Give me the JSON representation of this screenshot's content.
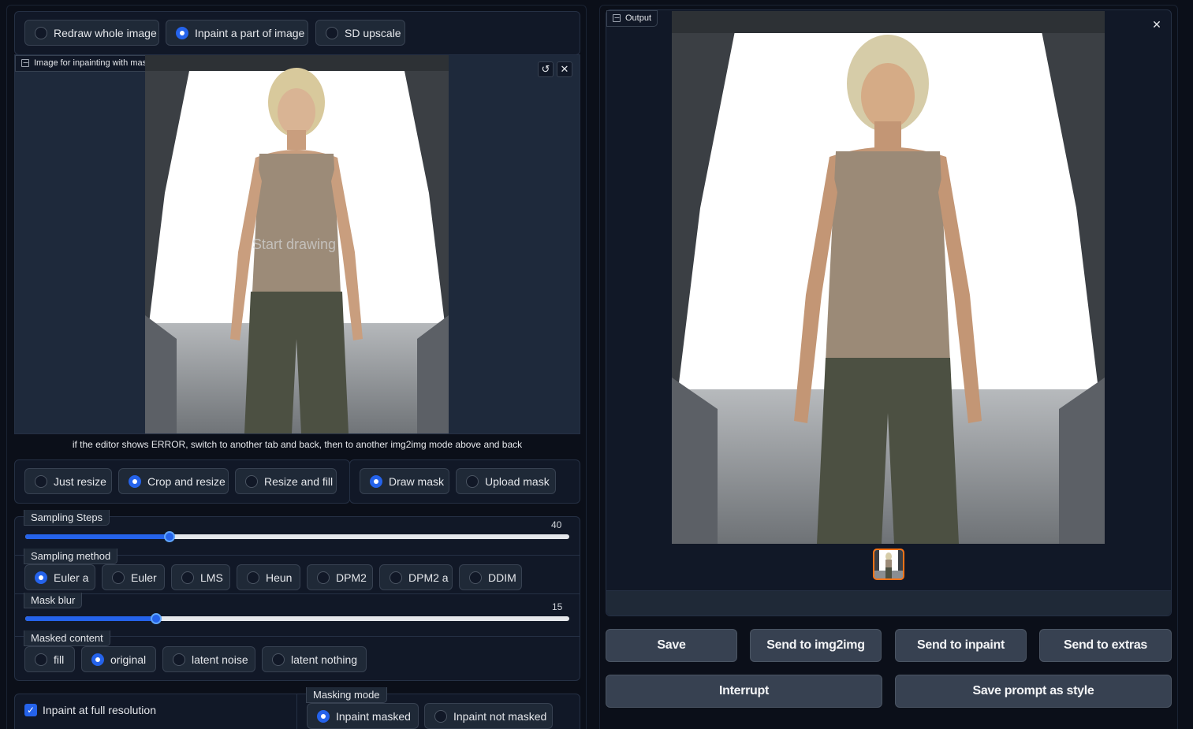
{
  "mode_tabs": [
    {
      "label": "Redraw whole image",
      "selected": false
    },
    {
      "label": "Inpaint a part of image",
      "selected": true
    },
    {
      "label": "SD upscale",
      "selected": false
    }
  ],
  "editor": {
    "label": "Image for inpainting with mask",
    "overlay_text": "Start drawing",
    "hint": "if the editor shows ERROR, switch to another tab and back, then to another img2img mode above and back"
  },
  "resize_modes": [
    {
      "label": "Just resize",
      "selected": false
    },
    {
      "label": "Crop and resize",
      "selected": true
    },
    {
      "label": "Resize and fill",
      "selected": false
    }
  ],
  "mask_modes": [
    {
      "label": "Draw mask",
      "selected": true
    },
    {
      "label": "Upload mask",
      "selected": false
    }
  ],
  "sampling_steps": {
    "label": "Sampling Steps",
    "value": "40",
    "fraction": 0.27
  },
  "sampling_method": {
    "label": "Sampling method",
    "options": [
      {
        "label": "Euler a",
        "selected": true
      },
      {
        "label": "Euler",
        "selected": false
      },
      {
        "label": "LMS",
        "selected": false
      },
      {
        "label": "Heun",
        "selected": false
      },
      {
        "label": "DPM2",
        "selected": false
      },
      {
        "label": "DPM2 a",
        "selected": false
      },
      {
        "label": "DDIM",
        "selected": false
      }
    ]
  },
  "mask_blur": {
    "label": "Mask blur",
    "value": "15",
    "fraction": 0.24
  },
  "masked_content": {
    "label": "Masked content",
    "options": [
      {
        "label": "fill",
        "selected": false
      },
      {
        "label": "original",
        "selected": true
      },
      {
        "label": "latent noise",
        "selected": false
      },
      {
        "label": "latent nothing",
        "selected": false
      }
    ]
  },
  "inpaint_full_res": {
    "label": "Inpaint at full resolution",
    "checked": true
  },
  "masking_mode": {
    "label": "Masking mode",
    "options": [
      {
        "label": "Inpaint masked",
        "selected": true
      },
      {
        "label": "Inpaint not masked",
        "selected": false
      }
    ]
  },
  "output": {
    "label": "Output"
  },
  "actions": {
    "save": "Save",
    "send_img2img": "Send to img2img",
    "send_inpaint": "Send to inpaint",
    "send_extras": "Send to extras",
    "interrupt": "Interrupt",
    "save_style": "Save prompt as style"
  },
  "colors": {
    "background": "#0b0f19",
    "panel": "#111827",
    "accent": "#2563eb",
    "thumb_border": "#f97316"
  }
}
